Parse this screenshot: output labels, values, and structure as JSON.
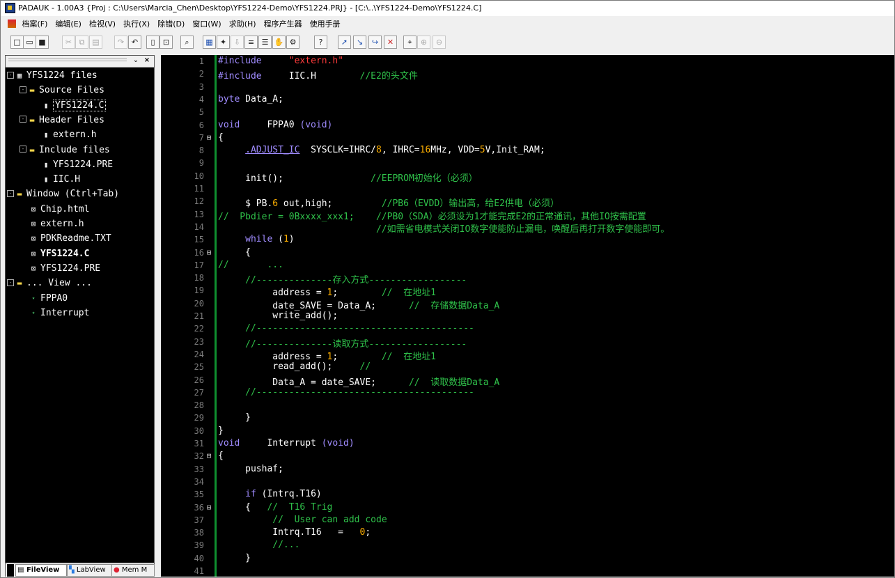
{
  "window": {
    "title": "PADAUK - 1.00A3 {Proj : C:\\Users\\Marcia_Chen\\Desktop\\YFS1224-Demo\\YFS1224.PRJ} - [C:\\..\\YFS1224-Demo\\YFS1224.C]"
  },
  "menu": {
    "items": [
      "档案(F)",
      "编辑(E)",
      "检视(V)",
      "执行(X)",
      "除错(D)",
      "窗口(W)",
      "求助(H)",
      "程序产生器",
      "使用手册"
    ]
  },
  "toolbar": {
    "buttons": [
      {
        "icon": "new-file-icon",
        "glyph": "□"
      },
      {
        "icon": "open-file-icon",
        "glyph": "▭"
      },
      {
        "icon": "save-icon",
        "glyph": "■"
      },
      {
        "icon": "cut-icon",
        "glyph": "✂"
      },
      {
        "icon": "copy-icon",
        "glyph": "⧉"
      },
      {
        "icon": "paste-icon",
        "glyph": "▤"
      },
      {
        "icon": "redo-icon",
        "glyph": "↷"
      },
      {
        "icon": "undo-icon",
        "glyph": "↶"
      },
      {
        "icon": "file-view-icon",
        "glyph": "▯"
      },
      {
        "icon": "find-window-icon",
        "glyph": "⊡"
      },
      {
        "icon": "find-replace-icon",
        "glyph": "⌕"
      },
      {
        "icon": "compile-icon",
        "glyph": "▦"
      },
      {
        "icon": "build-icon",
        "glyph": "✦"
      },
      {
        "icon": "download-icon",
        "glyph": "⇩"
      },
      {
        "icon": "writer-icon",
        "glyph": "≡"
      },
      {
        "icon": "list-icon",
        "glyph": "☰"
      },
      {
        "icon": "stop-icon",
        "glyph": "✋"
      },
      {
        "icon": "settings-icon",
        "glyph": "⚙"
      },
      {
        "icon": "help-icon",
        "glyph": "?"
      },
      {
        "icon": "run-icon",
        "glyph": "➚"
      },
      {
        "icon": "step-into-icon",
        "glyph": "↘"
      },
      {
        "icon": "step-over-icon",
        "glyph": "↪"
      },
      {
        "icon": "clear-breakpoints-icon",
        "glyph": "✕"
      },
      {
        "icon": "find-icon",
        "glyph": "⌖"
      },
      {
        "icon": "find-next-icon",
        "glyph": "⊕"
      },
      {
        "icon": "find-prev-icon",
        "glyph": "⊖"
      }
    ]
  },
  "file_tree": [
    {
      "label": "YFS1224 files",
      "level": 0,
      "icon": "project-icon",
      "exp": "-"
    },
    {
      "label": "Source Files",
      "level": 1,
      "icon": "folder-icon",
      "exp": "-"
    },
    {
      "label": "YFS1224.C",
      "level": 2,
      "icon": "file-icon",
      "selected": true
    },
    {
      "label": "Header Files",
      "level": 1,
      "icon": "folder-icon",
      "exp": "-"
    },
    {
      "label": "extern.h",
      "level": 2,
      "icon": "file-icon"
    },
    {
      "label": "Include files",
      "level": 1,
      "icon": "folder-icon",
      "exp": "-"
    },
    {
      "label": "YFS1224.PRE",
      "level": 2,
      "icon": "file-icon"
    },
    {
      "label": "IIC.H",
      "level": 2,
      "icon": "file-icon"
    },
    {
      "label": "Window (Ctrl+Tab)",
      "level": 0,
      "icon": "folder-icon",
      "exp": "-"
    },
    {
      "label": "Chip.html",
      "level": 1,
      "icon": "window-icon"
    },
    {
      "label": "extern.h",
      "level": 1,
      "icon": "window-icon"
    },
    {
      "label": "PDKReadme.TXT",
      "level": 1,
      "icon": "window-icon"
    },
    {
      "label": "YFS1224.C",
      "level": 1,
      "icon": "window-icon",
      "bold": true
    },
    {
      "label": "YFS1224.PRE",
      "level": 1,
      "icon": "window-icon"
    },
    {
      "label": "... View ...",
      "level": 0,
      "icon": "folder-icon",
      "exp": "-"
    },
    {
      "label": "FPPA0",
      "level": 1,
      "icon": "function-icon"
    },
    {
      "label": "Interrupt",
      "level": 1,
      "icon": "function-icon"
    }
  ],
  "sidebar_tabs": [
    "FileView",
    "LabView",
    "Mem M"
  ],
  "code_colors": {
    "plain": "#ffffff",
    "keyword": "#a08cff",
    "comment": "#2fc14a",
    "string": "#ff3b3b",
    "number": "#ffb000",
    "dot": "#ffb000"
  },
  "code": [
    {
      "n": 1,
      "fold": "",
      "segs": [
        [
          "#include",
          "k"
        ],
        [
          "     ",
          ""
        ],
        [
          "\"extern.h\"",
          "s"
        ]
      ]
    },
    {
      "n": 2,
      "fold": "",
      "segs": [
        [
          "#include",
          "k"
        ],
        [
          "     IIC.H        ",
          ""
        ],
        [
          "//E2的头文件",
          "c"
        ]
      ]
    },
    {
      "n": 3,
      "fold": "",
      "segs": []
    },
    {
      "n": 4,
      "fold": "",
      "segs": [
        [
          "byte",
          "k"
        ],
        [
          " Data_A;",
          ""
        ]
      ]
    },
    {
      "n": 5,
      "fold": "",
      "segs": []
    },
    {
      "n": 6,
      "fold": "",
      "segs": [
        [
          "void",
          "k"
        ],
        [
          "     FPPA0 ",
          ""
        ],
        [
          "(void)",
          "k"
        ]
      ]
    },
    {
      "n": 7,
      "fold": "⊟",
      "segs": [
        [
          "{",
          ""
        ]
      ]
    },
    {
      "n": 8,
      "fold": "",
      "segs": [
        [
          "     ",
          ""
        ],
        [
          ".ADJUST_IC",
          "k"
        ],
        [
          "  SYSCLK=IHRC/",
          ""
        ],
        [
          "8",
          "n"
        ],
        [
          ", IHRC=",
          ""
        ],
        [
          "16",
          "n"
        ],
        [
          "MHz, VDD=",
          ""
        ],
        [
          "5",
          "n"
        ],
        [
          "V,Init_RAM;",
          ""
        ]
      ]
    },
    {
      "n": 9,
      "fold": "",
      "segs": []
    },
    {
      "n": 10,
      "fold": "",
      "segs": [
        [
          "     init();                ",
          ""
        ],
        [
          "//EEPROM初始化（必须）",
          "c"
        ]
      ]
    },
    {
      "n": 11,
      "fold": "",
      "segs": []
    },
    {
      "n": 12,
      "fold": "",
      "segs": [
        [
          "     $ PB.",
          ""
        ],
        [
          "6",
          "n"
        ],
        [
          " out,high;         ",
          ""
        ],
        [
          "//PB6（EVDD）输出高，给E2供电（必须）",
          "c"
        ]
      ]
    },
    {
      "n": 13,
      "fold": "",
      "segs": [
        [
          "//  Pbdier = 0Bxxxx_xxx1;    //PB0（SDA）必须设为1才能完成E2的正常通讯，其他IO按需配置",
          "c"
        ]
      ]
    },
    {
      "n": 14,
      "fold": "",
      "segs": [
        [
          "                             ",
          ""
        ],
        [
          "//如需省电模式关闭IO数字使能防止漏电，唤醒后再打开数字使能即可。",
          "c"
        ]
      ]
    },
    {
      "n": 15,
      "fold": "",
      "segs": [
        [
          "     ",
          ""
        ],
        [
          "while",
          "k"
        ],
        [
          " (",
          ""
        ],
        [
          "1",
          "n"
        ],
        [
          ")",
          ""
        ]
      ]
    },
    {
      "n": 16,
      "fold": "⊟",
      "segs": [
        [
          "     {",
          ""
        ]
      ]
    },
    {
      "n": 17,
      "fold": "",
      "segs": [
        [
          "//       ...",
          "c"
        ]
      ]
    },
    {
      "n": 18,
      "fold": "",
      "segs": [
        [
          "     ",
          ""
        ],
        [
          "//--------------存入方式------------------",
          "c"
        ]
      ]
    },
    {
      "n": 19,
      "fold": "",
      "segs": [
        [
          "          address = ",
          ""
        ],
        [
          "1",
          "n"
        ],
        [
          ";        ",
          ""
        ],
        [
          "//  在地址1",
          "c"
        ]
      ]
    },
    {
      "n": 20,
      "fold": "",
      "segs": [
        [
          "          date_SAVE = Data_A;      ",
          ""
        ],
        [
          "//  存储数据Data_A",
          "c"
        ]
      ]
    },
    {
      "n": 21,
      "fold": "",
      "segs": [
        [
          "          write_add();",
          ""
        ]
      ]
    },
    {
      "n": 22,
      "fold": "",
      "segs": [
        [
          "     ",
          ""
        ],
        [
          "//----------------------------------------",
          "c"
        ]
      ]
    },
    {
      "n": 23,
      "fold": "",
      "segs": [
        [
          "     ",
          ""
        ],
        [
          "//--------------读取方式------------------",
          "c"
        ]
      ]
    },
    {
      "n": 24,
      "fold": "",
      "segs": [
        [
          "          address = ",
          ""
        ],
        [
          "1",
          "n"
        ],
        [
          ";        ",
          ""
        ],
        [
          "//  在地址1",
          "c"
        ]
      ]
    },
    {
      "n": 25,
      "fold": "",
      "segs": [
        [
          "          read_add();     ",
          ""
        ],
        [
          "//",
          "c"
        ]
      ]
    },
    {
      "n": 26,
      "fold": "",
      "segs": [
        [
          "          Data_A = date_SAVE;      ",
          ""
        ],
        [
          "//  读取数据Data_A",
          "c"
        ]
      ]
    },
    {
      "n": 27,
      "fold": "",
      "segs": [
        [
          "     ",
          ""
        ],
        [
          "//----------------------------------------",
          "c"
        ]
      ]
    },
    {
      "n": 28,
      "fold": "",
      "segs": []
    },
    {
      "n": 29,
      "fold": "",
      "segs": [
        [
          "     }",
          ""
        ]
      ]
    },
    {
      "n": 30,
      "fold": "",
      "segs": [
        [
          "}",
          ""
        ]
      ]
    },
    {
      "n": 31,
      "fold": "",
      "segs": [
        [
          "void",
          "k"
        ],
        [
          "     Interrupt ",
          ""
        ],
        [
          "(void)",
          "k"
        ]
      ]
    },
    {
      "n": 32,
      "fold": "⊟",
      "segs": [
        [
          "{",
          ""
        ]
      ]
    },
    {
      "n": 33,
      "fold": "",
      "segs": [
        [
          "     pushaf;",
          ""
        ]
      ]
    },
    {
      "n": 34,
      "fold": "",
      "segs": []
    },
    {
      "n": 35,
      "fold": "",
      "segs": [
        [
          "     ",
          ""
        ],
        [
          "if",
          "k"
        ],
        [
          " (Intrq.T16)",
          ""
        ]
      ]
    },
    {
      "n": 36,
      "fold": "⊟",
      "segs": [
        [
          "     {   ",
          ""
        ],
        [
          "//  T16 Trig",
          "c"
        ]
      ]
    },
    {
      "n": 37,
      "fold": "",
      "segs": [
        [
          "          ",
          ""
        ],
        [
          "//  User can add code",
          "c"
        ]
      ]
    },
    {
      "n": 38,
      "fold": "",
      "segs": [
        [
          "          Intrq.T16   =   ",
          ""
        ],
        [
          "0",
          "n"
        ],
        [
          ";",
          ""
        ]
      ]
    },
    {
      "n": 39,
      "fold": "",
      "segs": [
        [
          "          ",
          ""
        ],
        [
          "//...",
          "c"
        ]
      ]
    },
    {
      "n": 40,
      "fold": "",
      "segs": [
        [
          "     }",
          ""
        ]
      ]
    },
    {
      "n": 41,
      "fold": "",
      "segs": []
    }
  ]
}
